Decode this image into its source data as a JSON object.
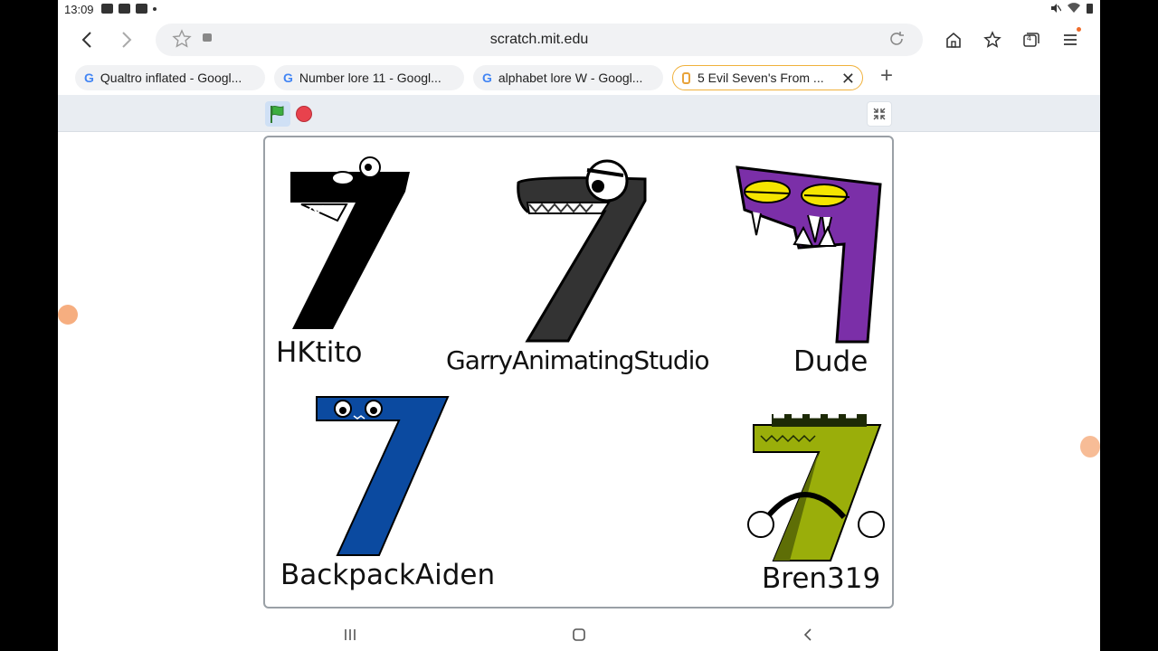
{
  "status_bar": {
    "time": "13:09",
    "icons": [
      "video-icon",
      "mail-icon",
      "gallery-icon",
      "flipboard-icon"
    ],
    "right_icons": [
      "mute-icon",
      "wifi-icon",
      "battery-icon"
    ]
  },
  "browser": {
    "url": "scratch.mit.edu",
    "tabs": [
      {
        "label": "Qualtro inflated - Googl...",
        "favicon": "google-icon",
        "active": false
      },
      {
        "label": "Number lore 11 - Googl...",
        "favicon": "google-icon",
        "active": false
      },
      {
        "label": "alphabet lore W - Googl...",
        "favicon": "google-icon",
        "active": false
      },
      {
        "label": "5 Evil Seven's From ...",
        "favicon": "scratch-icon",
        "active": true
      }
    ],
    "tab_count": "4"
  },
  "stage": {
    "characters": [
      {
        "name": "HKtito",
        "color": "#000000"
      },
      {
        "name": "GarryAnimatingStudio",
        "color": "#333333"
      },
      {
        "name": "Dude",
        "color": "#7b2fa8"
      },
      {
        "name": "BackpackAiden",
        "color": "#0b4aa0"
      },
      {
        "name": "Bren319",
        "color": "#9aae0a"
      }
    ]
  },
  "colors": {
    "accent_tab": "#f0b13c",
    "stop": "#e8424d",
    "flag": "#2e9c3a"
  }
}
